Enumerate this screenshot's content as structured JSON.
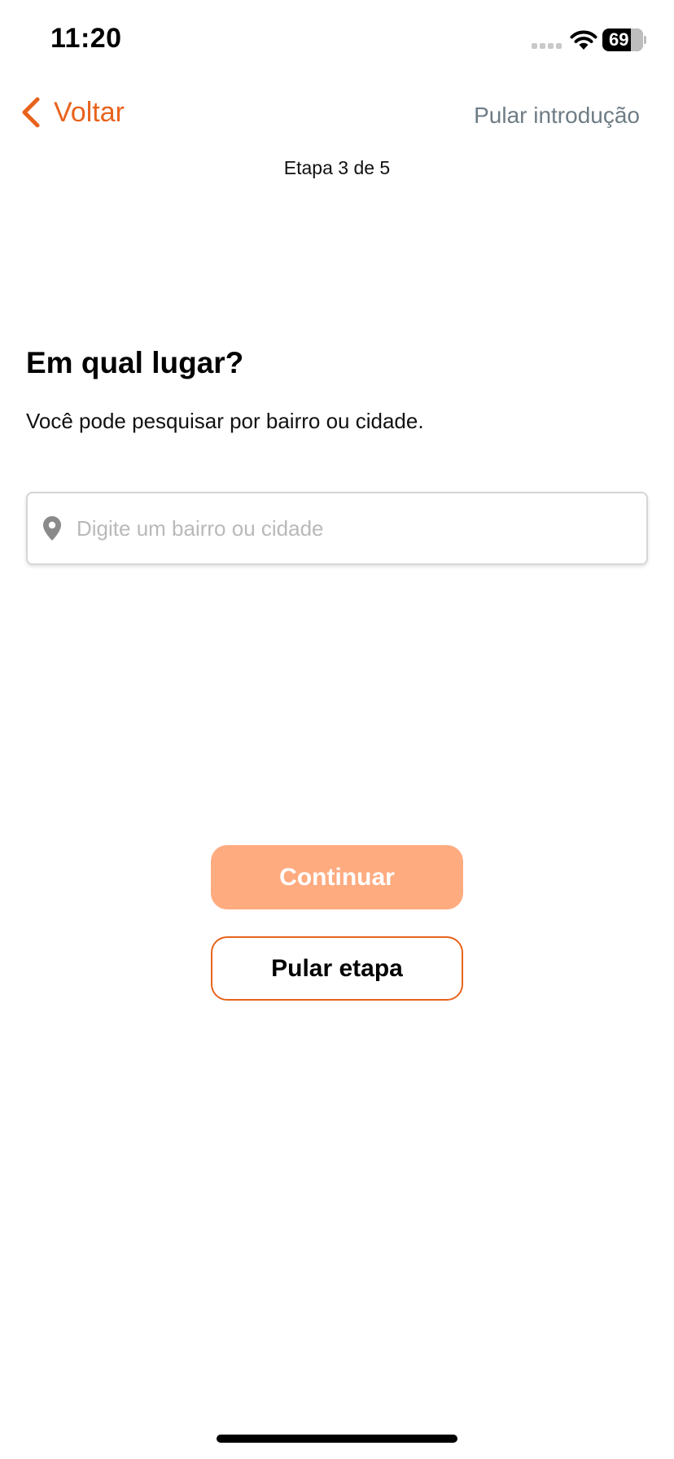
{
  "status_bar": {
    "time": "11:20",
    "battery_level": "69"
  },
  "nav": {
    "back_label": "Voltar",
    "skip_intro_label": "Pular introdução",
    "step_indicator": "Etapa 3 de 5"
  },
  "content": {
    "title": "Em qual lugar?",
    "subtitle": "Você pode pesquisar por bairro ou cidade.",
    "search": {
      "placeholder": "Digite um bairro ou cidade",
      "value": ""
    }
  },
  "actions": {
    "continue_label": "Continuar",
    "skip_step_label": "Pular etapa"
  },
  "colors": {
    "accent": "#e8631c",
    "continue_disabled_bg": "#ffab80",
    "secondary_text": "#6e7c85",
    "placeholder": "#b9b9b9"
  },
  "icons": {
    "back": "chevron-left-icon",
    "location": "location-pin-icon",
    "wifi": "wifi-icon",
    "signal": "cellular-signal-icon",
    "battery": "battery-icon"
  }
}
